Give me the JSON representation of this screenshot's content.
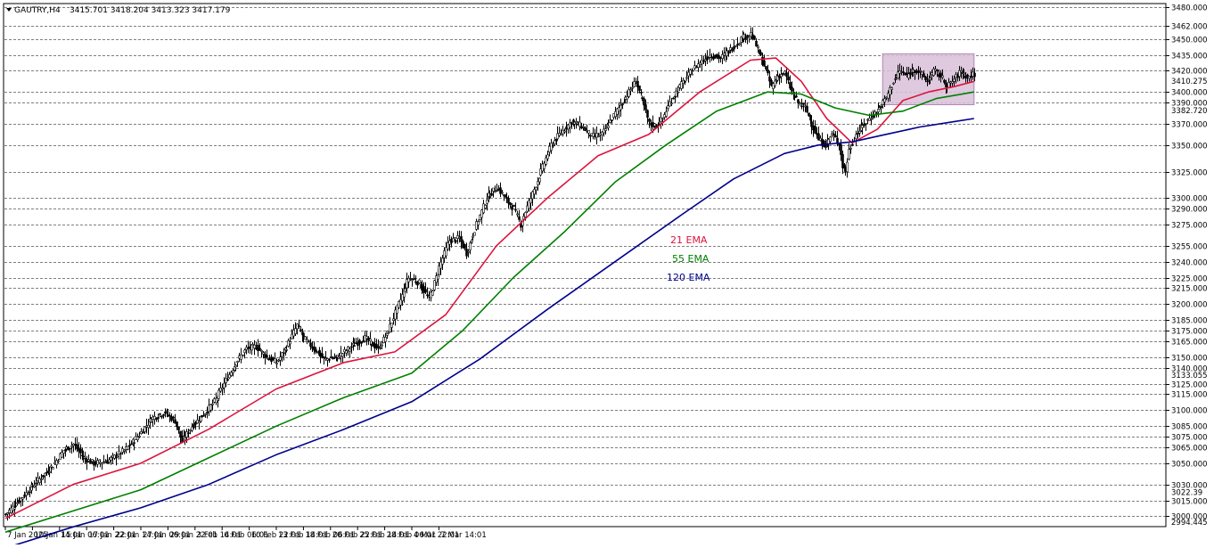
{
  "header": {
    "symbol_timeframe": "GAUTRY,H4",
    "ohlc": "3415.701 3418.204 3413.323 3417.179"
  },
  "colors": {
    "background": "#ffffff",
    "grid": "#000000",
    "candle": "#000000",
    "ema21": "#dc143c",
    "ema55": "#008000",
    "ema120": "#00008b",
    "range_box": "#d8bfd8"
  },
  "chart_data": {
    "type": "candlestick",
    "title": "GAUTRY,H4",
    "ylim": [
      2994.445,
      3480
    ],
    "grid": true,
    "y_ticks": [
      3480,
      3462,
      3450,
      3435,
      3420,
      3400,
      3390,
      3370,
      3350,
      3325,
      3300,
      3290,
      3275,
      3255,
      3240,
      3225,
      3215,
      3200,
      3185,
      3175,
      3165,
      3150,
      3140,
      3125,
      3115,
      3100,
      3085,
      3075,
      3065,
      3050,
      3030,
      3015,
      3000
    ],
    "y_tick_labels": [
      "3480.000",
      "3462.000",
      "3450.000",
      "3435.000",
      "3420.000",
      "3400.000",
      "3390.000",
      "3370.000",
      "3350.000",
      "3325.000",
      "3300.000",
      "3290.000",
      "3275.000",
      "3255.000",
      "3240.000",
      "3225.000",
      "3215.000",
      "3200.000",
      "3185.000",
      "3175.000",
      "3165.000",
      "3150.000",
      "3140.000",
      "3125.000",
      "3115.000",
      "3100.000",
      "3085.000",
      "3075.000",
      "3065.000",
      "3050.000",
      "3030.000",
      "3015.000",
      "3000.000"
    ],
    "extra_labels": [
      {
        "value": 3410.275,
        "text": "3410.275"
      },
      {
        "value": 3382.72,
        "text": "3382.720"
      },
      {
        "value": 3133.055,
        "text": "3133.055"
      },
      {
        "value": 3022.39,
        "text": "3022.39"
      },
      {
        "value": 2994.445,
        "text": "2994.445"
      }
    ],
    "x_labels": [
      "7 Jan 2025",
      "10 Jan 14:01",
      "15 Jan 06:01",
      "17 Jan 22:01",
      "22 Jan 14:01",
      "27 Jan 06:01",
      "29 Jan 22:01",
      "3 Feb 14:01",
      "6 Feb 06:01",
      "10 Feb 22:01",
      "13 Feb 14:01",
      "18 Feb 06:01",
      "20 Feb 22:01",
      "25 Feb 14:01",
      "28 Feb 06:01",
      "4 Mar 22:01",
      "7 Mar 14:01"
    ],
    "bars_per_label": 16,
    "close_path": [
      [
        0,
        3002
      ],
      [
        8,
        3015
      ],
      [
        18,
        3032
      ],
      [
        28,
        3048
      ],
      [
        34,
        3062
      ],
      [
        40,
        3068
      ],
      [
        46,
        3055
      ],
      [
        52,
        3050
      ],
      [
        60,
        3052
      ],
      [
        70,
        3062
      ],
      [
        78,
        3075
      ],
      [
        86,
        3092
      ],
      [
        94,
        3098
      ],
      [
        100,
        3090
      ],
      [
        104,
        3070
      ],
      [
        110,
        3085
      ],
      [
        118,
        3098
      ],
      [
        124,
        3110
      ],
      [
        130,
        3128
      ],
      [
        136,
        3145
      ],
      [
        142,
        3158
      ],
      [
        148,
        3160
      ],
      [
        154,
        3150
      ],
      [
        160,
        3145
      ],
      [
        166,
        3160
      ],
      [
        172,
        3180
      ],
      [
        176,
        3168
      ],
      [
        182,
        3158
      ],
      [
        188,
        3148
      ],
      [
        196,
        3150
      ],
      [
        204,
        3160
      ],
      [
        212,
        3168
      ],
      [
        220,
        3158
      ],
      [
        226,
        3175
      ],
      [
        232,
        3200
      ],
      [
        238,
        3225
      ],
      [
        244,
        3220
      ],
      [
        250,
        3205
      ],
      [
        256,
        3235
      ],
      [
        262,
        3260
      ],
      [
        268,
        3262
      ],
      [
        272,
        3248
      ],
      [
        278,
        3275
      ],
      [
        284,
        3300
      ],
      [
        290,
        3310
      ],
      [
        296,
        3298
      ],
      [
        300,
        3290
      ],
      [
        304,
        3275
      ],
      [
        310,
        3300
      ],
      [
        316,
        3325
      ],
      [
        322,
        3350
      ],
      [
        328,
        3362
      ],
      [
        334,
        3372
      ],
      [
        340,
        3368
      ],
      [
        346,
        3358
      ],
      [
        352,
        3360
      ],
      [
        358,
        3375
      ],
      [
        364,
        3390
      ],
      [
        368,
        3400
      ],
      [
        372,
        3410
      ],
      [
        376,
        3392
      ],
      [
        380,
        3370
      ],
      [
        384,
        3368
      ],
      [
        388,
        3375
      ],
      [
        392,
        3390
      ],
      [
        398,
        3405
      ],
      [
        404,
        3418
      ],
      [
        410,
        3428
      ],
      [
        416,
        3435
      ],
      [
        422,
        3432
      ],
      [
        428,
        3440
      ],
      [
        434,
        3450
      ],
      [
        440,
        3455
      ],
      [
        444,
        3440
      ],
      [
        448,
        3425
      ],
      [
        452,
        3405
      ],
      [
        456,
        3415
      ],
      [
        460,
        3418
      ],
      [
        464,
        3400
      ],
      [
        468,
        3390
      ],
      [
        472,
        3385
      ],
      [
        476,
        3370
      ],
      [
        480,
        3355
      ],
      [
        484,
        3350
      ],
      [
        488,
        3360
      ],
      [
        492,
        3352
      ],
      [
        494,
        3330
      ],
      [
        496,
        3325
      ],
      [
        498,
        3345
      ],
      [
        502,
        3360
      ],
      [
        506,
        3368
      ],
      [
        510,
        3375
      ],
      [
        516,
        3385
      ],
      [
        520,
        3395
      ],
      [
        524,
        3410
      ],
      [
        528,
        3420
      ],
      [
        532,
        3415
      ],
      [
        536,
        3422
      ],
      [
        540,
        3418
      ],
      [
        544,
        3410
      ],
      [
        548,
        3420
      ],
      [
        552,
        3415
      ],
      [
        556,
        3405
      ],
      [
        560,
        3412
      ],
      [
        564,
        3420
      ],
      [
        568,
        3414
      ],
      [
        572,
        3417
      ]
    ],
    "series": [
      {
        "name": "21 EMA",
        "color": "#dc143c",
        "points": [
          [
            0,
            2998
          ],
          [
            40,
            3030
          ],
          [
            80,
            3050
          ],
          [
            120,
            3082
          ],
          [
            160,
            3120
          ],
          [
            200,
            3145
          ],
          [
            230,
            3155
          ],
          [
            260,
            3190
          ],
          [
            290,
            3255
          ],
          [
            320,
            3300
          ],
          [
            350,
            3340
          ],
          [
            380,
            3360
          ],
          [
            410,
            3400
          ],
          [
            440,
            3430
          ],
          [
            455,
            3432
          ],
          [
            470,
            3410
          ],
          [
            485,
            3375
          ],
          [
            500,
            3352
          ],
          [
            515,
            3365
          ],
          [
            530,
            3392
          ],
          [
            545,
            3400
          ],
          [
            560,
            3405
          ],
          [
            572,
            3410
          ]
        ]
      },
      {
        "name": "55 EMA",
        "color": "#008000",
        "points": [
          [
            0,
            2985
          ],
          [
            40,
            3005
          ],
          [
            80,
            3025
          ],
          [
            120,
            3055
          ],
          [
            160,
            3085
          ],
          [
            200,
            3112
          ],
          [
            240,
            3135
          ],
          [
            270,
            3175
          ],
          [
            300,
            3225
          ],
          [
            330,
            3268
          ],
          [
            360,
            3315
          ],
          [
            390,
            3350
          ],
          [
            420,
            3382
          ],
          [
            450,
            3400
          ],
          [
            470,
            3398
          ],
          [
            490,
            3385
          ],
          [
            510,
            3378
          ],
          [
            530,
            3382
          ],
          [
            550,
            3394
          ],
          [
            565,
            3398
          ],
          [
            572,
            3400
          ]
        ]
      },
      {
        "name": "120 EMA",
        "color": "#00008b",
        "points": [
          [
            0,
            2970
          ],
          [
            40,
            2990
          ],
          [
            80,
            3008
          ],
          [
            120,
            3030
          ],
          [
            160,
            3058
          ],
          [
            200,
            3082
          ],
          [
            240,
            3108
          ],
          [
            280,
            3148
          ],
          [
            320,
            3195
          ],
          [
            360,
            3240
          ],
          [
            400,
            3285
          ],
          [
            430,
            3318
          ],
          [
            460,
            3342
          ],
          [
            480,
            3350
          ],
          [
            500,
            3353
          ],
          [
            520,
            3360
          ],
          [
            540,
            3367
          ],
          [
            560,
            3372
          ],
          [
            572,
            3375
          ]
        ]
      }
    ],
    "annotations": [
      {
        "text": "21 EMA",
        "color": "#dc143c"
      },
      {
        "text": "55 EMA",
        "color": "#008000"
      },
      {
        "text": "120 EMA",
        "color": "#00008b"
      }
    ],
    "range_box": {
      "x_from": 518,
      "x_to": 572,
      "y_low": 3388,
      "y_high": 3436
    }
  }
}
